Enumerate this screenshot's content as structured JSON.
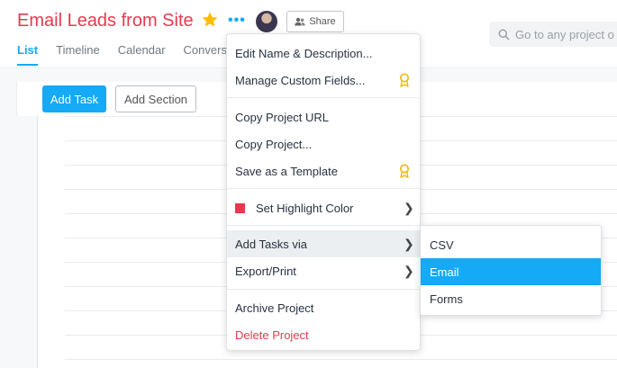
{
  "project": {
    "title": "Email Leads from Site",
    "favorite_icon": "star-icon",
    "more_icon": "ellipsis-icon",
    "share_label": "Share",
    "accent_color": "#e8384f",
    "star_color": "#fcbd01"
  },
  "search": {
    "placeholder": "Go to any project o"
  },
  "tabs": [
    {
      "label": "List",
      "active": true
    },
    {
      "label": "Timeline"
    },
    {
      "label": "Calendar"
    },
    {
      "label": "Convers"
    }
  ],
  "toolbar": {
    "add_task_label": "Add Task",
    "add_section_label": "Add Section",
    "primary_color": "#14aaf5"
  },
  "menu": {
    "items": [
      {
        "label": "Edit Name & Description..."
      },
      {
        "label": "Manage Custom Fields...",
        "icon": "premium-badge-icon"
      },
      {
        "label": "Copy Project URL"
      },
      {
        "label": "Copy Project..."
      },
      {
        "label": "Save as a Template",
        "icon": "premium-badge-icon"
      },
      {
        "label": "Set Highlight Color",
        "swatch_color": "#e8384f",
        "submenu": true
      },
      {
        "label": "Add Tasks via",
        "submenu": true,
        "highlighted": true
      },
      {
        "label": "Export/Print",
        "submenu": true
      },
      {
        "label": "Archive Project"
      },
      {
        "label": "Delete Project",
        "danger": true
      }
    ]
  },
  "submenu": {
    "items": [
      {
        "label": "CSV"
      },
      {
        "label": "Email",
        "selected": true
      },
      {
        "label": "Forms"
      }
    ]
  }
}
